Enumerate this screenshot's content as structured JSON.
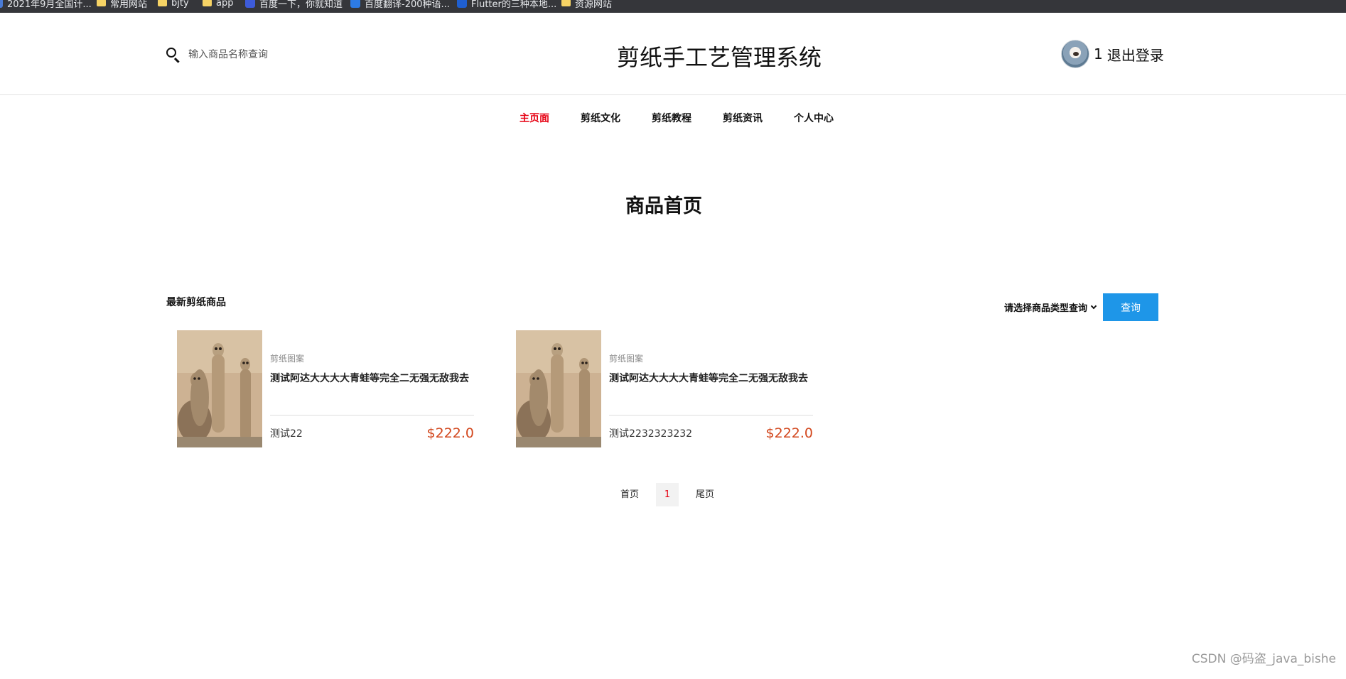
{
  "bookmarks": [
    {
      "label": "2021年9月全国计...",
      "icon": "folder-icon"
    },
    {
      "label": "常用网站",
      "icon": "folder-icon"
    },
    {
      "label": "bjty",
      "icon": "folder-icon"
    },
    {
      "label": "app",
      "icon": "folder-icon"
    },
    {
      "label": "百度一下，你就知道",
      "icon": "baidu-icon"
    },
    {
      "label": "百度翻译-200种语...",
      "icon": "translate-icon"
    },
    {
      "label": "Flutter的三种本地...",
      "icon": "xu-icon"
    },
    {
      "label": "资源网站",
      "icon": "folder-icon"
    }
  ],
  "header": {
    "search_placeholder": "输入商品名称查询",
    "site_title": "剪纸手工艺管理系统",
    "user_name": "1",
    "logout": "退出登录"
  },
  "nav": {
    "items": [
      "主页面",
      "剪纸文化",
      "剪纸教程",
      "剪纸资讯",
      "个人中心"
    ],
    "active_index": 0
  },
  "page_heading": "商品首页",
  "section": {
    "title": "最新剪纸商品",
    "type_select": "请选择商品类型查询",
    "query_button": "查询"
  },
  "products": [
    {
      "category": "剪纸图案",
      "name": "测试阿达大大大大青蛙等完全二无强无敌我去",
      "desc": "测试22",
      "price": "$222.0"
    },
    {
      "category": "剪纸图案",
      "name": "测试阿达大大大大青蛙等完全二无强无敌我去",
      "desc": "测试2232323232",
      "price": "$222.0"
    }
  ],
  "pagination": {
    "first": "首页",
    "current": "1",
    "last": "尾页"
  },
  "watermark": "CSDN @码盗_java_bishe",
  "colors": {
    "accent_red": "#e60012",
    "button_blue": "#1e96e8",
    "price": "#d2461c"
  }
}
